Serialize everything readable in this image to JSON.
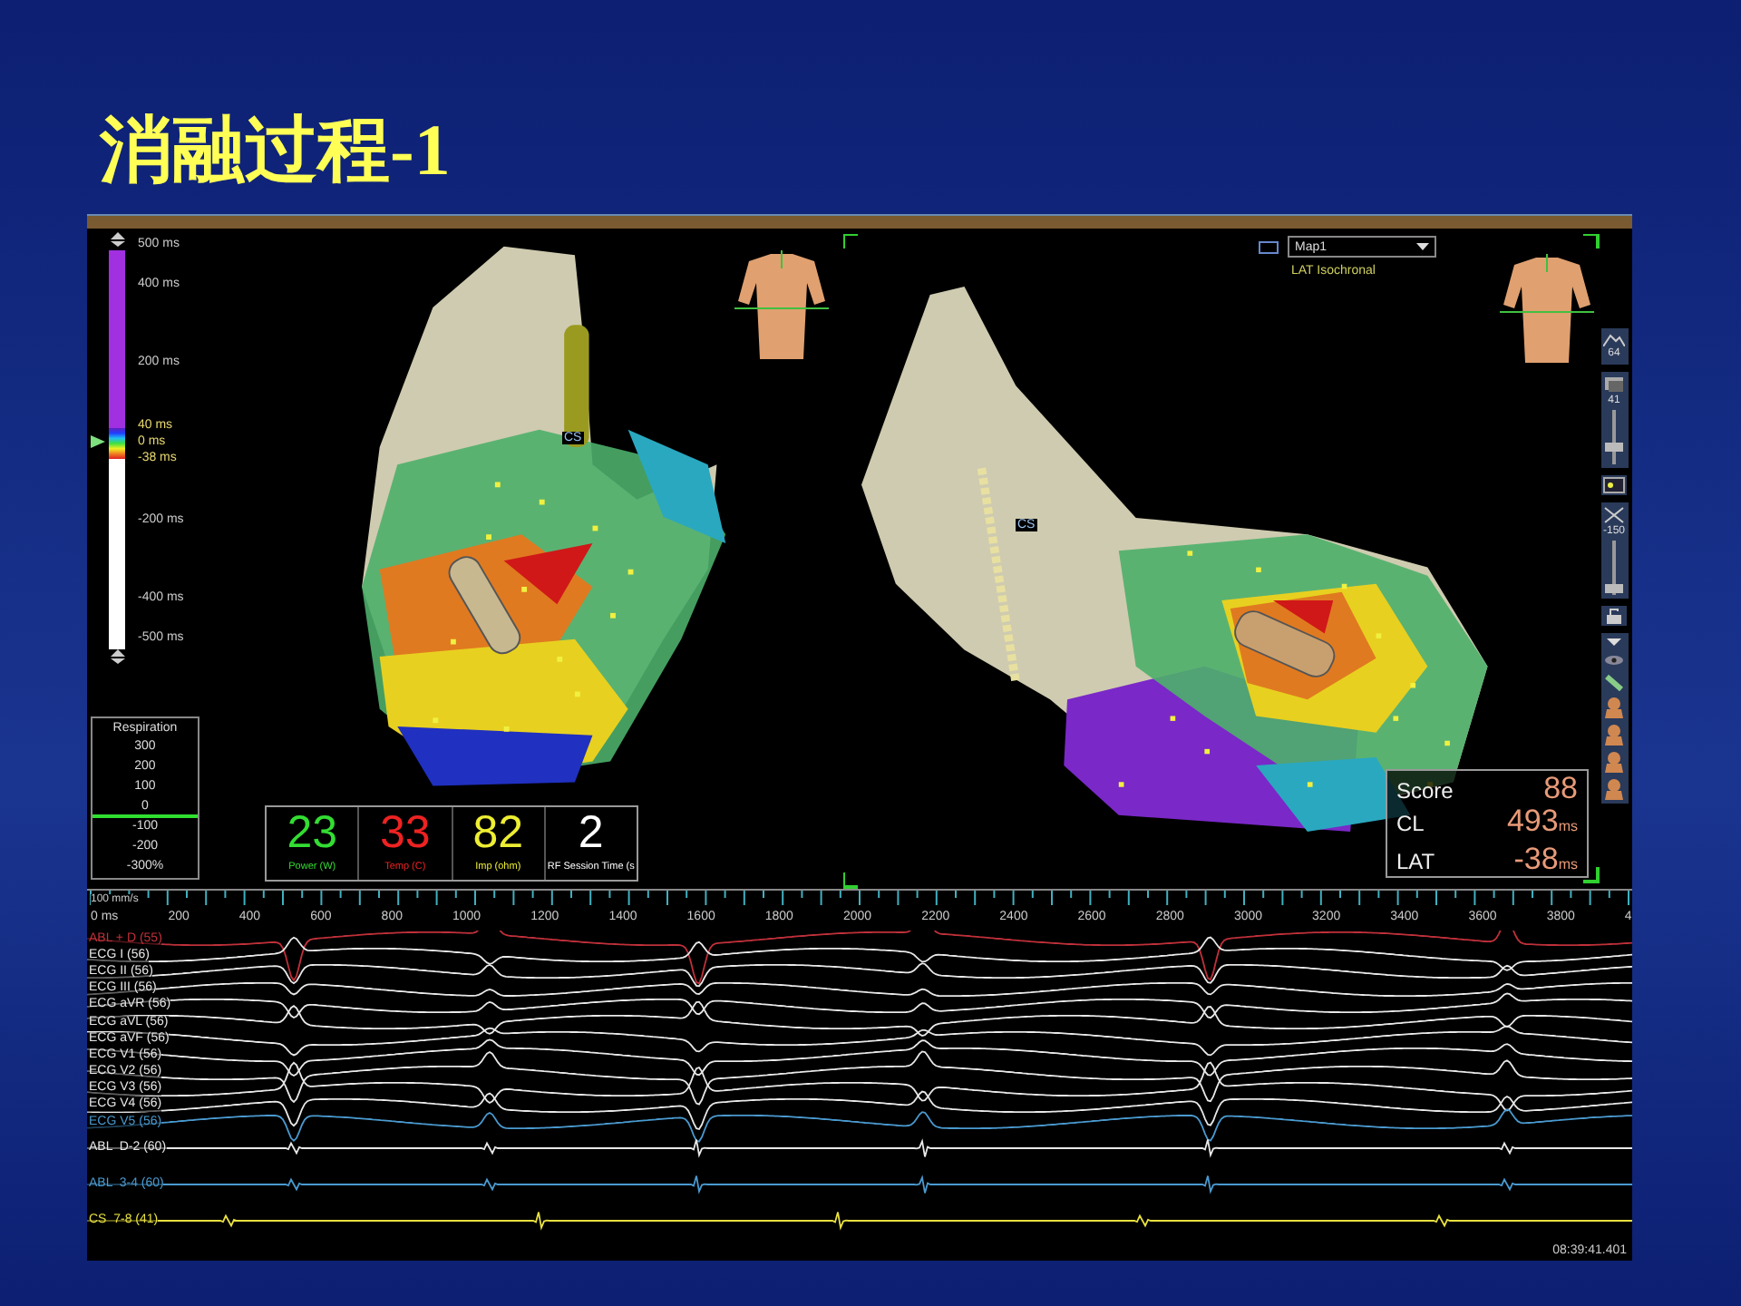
{
  "title": "消融过程-1",
  "left_view": {
    "colorbar_labels": [
      "500 ms",
      "400 ms",
      "200 ms",
      "40 ms",
      "0 ms",
      "-38 ms",
      "-200 ms",
      "-400 ms",
      "-500 ms"
    ],
    "catheter_label": "CS",
    "respiration": {
      "title": "Respiration",
      "ticks": [
        "300",
        "200",
        "100",
        "0",
        "-100",
        "-200",
        "-300%"
      ]
    },
    "rf_readouts": [
      {
        "value": "23",
        "label": "Power (W)",
        "color": "#33dd33"
      },
      {
        "value": "33",
        "label": "Temp (C)",
        "color": "#ee2222"
      },
      {
        "value": "82",
        "label": "Imp (ohm)",
        "color": "#eeee33"
      },
      {
        "value": "2",
        "label": "RF Session Time (s",
        "color": "#ffffff"
      }
    ]
  },
  "right_view": {
    "map_select": {
      "value": "Map1"
    },
    "map_type": "LAT Isochronal",
    "catheter_label": "CS",
    "toolbar": {
      "zoom_value": "64",
      "sliders": [
        {
          "value": "41",
          "level": 0.25
        },
        {
          "value": "-150",
          "level": 0.05
        }
      ]
    },
    "score_panel": [
      {
        "label": "Score",
        "value": "88"
      },
      {
        "label": "CL",
        "value": "493",
        "unit": "ms"
      },
      {
        "label": "LAT",
        "value": "-38",
        "unit": "ms"
      }
    ]
  },
  "ecg": {
    "speed": "100 mm/s",
    "ticks": [
      "0 ms",
      "200",
      "400",
      "600",
      "800",
      "1000",
      "1200",
      "1400",
      "1600",
      "1800",
      "2000",
      "2200",
      "2400",
      "2600",
      "2800",
      "3000",
      "3200",
      "3400",
      "3600",
      "3800",
      "4"
    ],
    "channels": [
      {
        "name": "ABL + D (55)",
        "kind": "ecg",
        "color": "#c0303a"
      },
      {
        "name": "ECG I (56)",
        "kind": "ecg",
        "color": "#e8e8e8"
      },
      {
        "name": "ECG II (56)",
        "kind": "ecg",
        "color": "#e8e8e8"
      },
      {
        "name": "ECG III (56)",
        "kind": "ecg",
        "color": "#e8e8e8"
      },
      {
        "name": "ECG aVR (56)",
        "kind": "ecg",
        "color": "#e8e8e8"
      },
      {
        "name": "ECG aVL (56)",
        "kind": "ecg",
        "color": "#e8e8e8"
      },
      {
        "name": "ECG aVF (56)",
        "kind": "ecg",
        "color": "#e8e8e8"
      },
      {
        "name": "ECG V1 (56)",
        "kind": "ecg",
        "color": "#e8e8e8"
      },
      {
        "name": "ECG V2 (56)",
        "kind": "ecg",
        "color": "#e8e8e8"
      },
      {
        "name": "ECG V3 (56)",
        "kind": "ecg",
        "color": "#e8e8e8"
      },
      {
        "name": "ECG V4 (56)",
        "kind": "ecg",
        "color": "#e8e8e8"
      },
      {
        "name": "ECG V5 (56)",
        "kind": "ecg",
        "color": "#4a9ad0"
      },
      {
        "name": "ABL  D-2 (60)",
        "kind": "intracardiac",
        "color": "#e8e8e8"
      },
      {
        "name": "ABL  3-4 (60)",
        "kind": "intracardiac",
        "color": "#4a9ad0"
      },
      {
        "name": "CS  7-8 (41)",
        "kind": "intracardiac",
        "color": "#e8e040"
      }
    ],
    "timestamp": "08:39:41.401"
  }
}
